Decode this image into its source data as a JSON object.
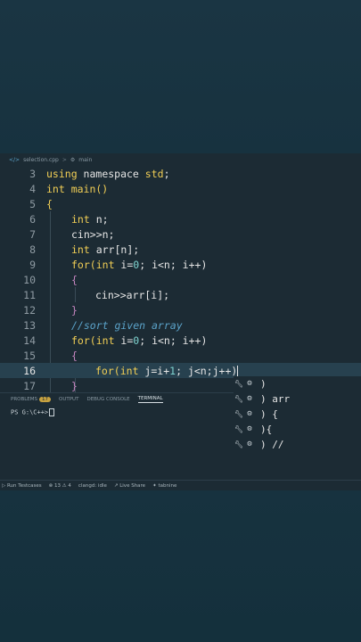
{
  "breadcrumb": {
    "file": "selection.cpp",
    "sep": ">",
    "symbol": "main"
  },
  "code": {
    "lines": [
      {
        "n": "3"
      },
      {
        "n": "4"
      },
      {
        "n": "5"
      },
      {
        "n": "6"
      },
      {
        "n": "7"
      },
      {
        "n": "8"
      },
      {
        "n": "9"
      },
      {
        "n": "10"
      },
      {
        "n": "11"
      },
      {
        "n": "12"
      },
      {
        "n": "13"
      },
      {
        "n": "14"
      },
      {
        "n": "15"
      },
      {
        "n": "16"
      },
      {
        "n": "17"
      }
    ],
    "t3_kw": "using",
    "t3_rest": " namespace ",
    "t3_std": "std",
    "t3_end": ";",
    "t4": "int main()",
    "t5": "{",
    "t6_kw": "int",
    "t6_rest": " n;",
    "t7": "cin>>n;",
    "t8_kw": "int",
    "t8_rest": " arr[n];",
    "t9_kw": "for",
    "t9_a": "(",
    "t9_int": "int",
    "t9_b": " i=",
    "t9_0": "0",
    "t9_c": "; i<n; i++)",
    "t10": "{",
    "t11": "cin>>arr[i];",
    "t12": "}",
    "t13": "//sort given array",
    "t14_kw": "for",
    "t14_a": "(",
    "t14_int": "int",
    "t14_b": " i=",
    "t14_0": "0",
    "t14_c": "; i<n; i++)",
    "t15": "{",
    "t16_kw": "for",
    "t16_a": "(",
    "t16_int": "int",
    "t16_b": " j=i+",
    "t16_1": "1",
    "t16_c": "; j<n;j++)",
    "t17": "}"
  },
  "suggestions": [
    {
      "icon": "wrench-icon",
      "text": ")"
    },
    {
      "icon": "wrench-icon",
      "text": ") arr"
    },
    {
      "icon": "wrench-icon",
      "text": ") {"
    },
    {
      "icon": "wrench-icon",
      "text": "){"
    },
    {
      "icon": "wrench-icon",
      "text": ") //"
    }
  ],
  "panel": {
    "tabs": [
      "PROBLEMS",
      "OUTPUT",
      "DEBUG CONSOLE",
      "TERMINAL"
    ],
    "problems_count": "17",
    "terminal_prompt": "PS G:\\C++>"
  },
  "status": {
    "run": "Run Testcases",
    "errors": "⊗ 13 ⚠ 4",
    "clangd": "clangd: idle",
    "live": "Live Share",
    "tabnine": "tabnine"
  },
  "colors": {
    "keyword": "#f2cf55",
    "number": "#7fd4d0",
    "comment": "#5ba3c9",
    "editor_bg": "#1c2b34"
  }
}
